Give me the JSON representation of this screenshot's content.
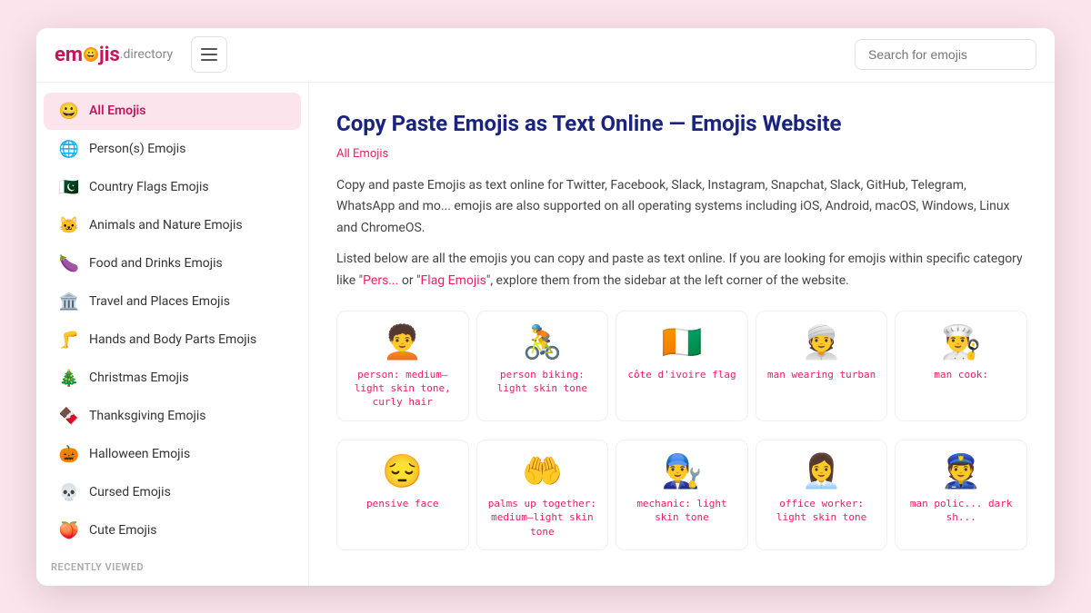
{
  "header": {
    "logo_text": "emojis",
    "logo_dot": ".",
    "logo_directory": "directory",
    "logo_emoji": "😀",
    "hamburger_label": "Menu",
    "search_placeholder": "Search for emojis"
  },
  "sidebar": {
    "items": [
      {
        "id": "all",
        "emoji": "😀",
        "label": "All Emojis",
        "active": true
      },
      {
        "id": "persons",
        "emoji": "🌐",
        "label": "Person(s) Emojis",
        "active": false
      },
      {
        "id": "flags",
        "emoji": "🇵🇰",
        "label": "Country Flags Emojis",
        "active": false
      },
      {
        "id": "animals",
        "emoji": "🐱",
        "label": "Animals and Nature Emojis",
        "active": false
      },
      {
        "id": "food",
        "emoji": "🍆",
        "label": "Food and Drinks Emojis",
        "active": false
      },
      {
        "id": "travel",
        "emoji": "🏛️",
        "label": "Travel and Places Emojis",
        "active": false
      },
      {
        "id": "hands",
        "emoji": "🦵",
        "label": "Hands and Body Parts Emojis",
        "active": false
      },
      {
        "id": "christmas",
        "emoji": "🎄",
        "label": "Christmas Emojis",
        "active": false
      },
      {
        "id": "thanksgiving",
        "emoji": "🍫",
        "label": "Thanksgiving Emojis",
        "active": false
      },
      {
        "id": "halloween",
        "emoji": "🎃",
        "label": "Halloween Emojis",
        "active": false
      },
      {
        "id": "cursed",
        "emoji": "💀",
        "label": "Cursed Emojis",
        "active": false
      },
      {
        "id": "cute",
        "emoji": "🍑",
        "label": "Cute Emojis",
        "active": false
      }
    ],
    "recently_viewed_label": "RECENTLY VIEWED"
  },
  "content": {
    "page_title": "Copy Paste Emojis as Text Online — Emojis Website",
    "breadcrumb": "All Emojis",
    "description1": "Copy and paste Emojis as text online for Twitter, Facebook, Slack, Instagram, Snapchat, Slack, GitHub, Telegram, WhatsApp and mo... emojis are also supported on all operating systems including iOS, Android, macOS, Windows, Linux and ChromeOS.",
    "description2": "Listed below are all the emojis you can copy and paste as text online. If you are looking for emojis within specific category like \"Pers... or \"Flag Emojis\", explore them from the sidebar at the left corner of the website.",
    "link_persons": "Pers...",
    "link_flags": "Flag Emojis"
  },
  "emoji_cards": {
    "row1": [
      {
        "emoji": "🧑‍🦱",
        "name": "person: medium–light\nskin tone, curly hair"
      },
      {
        "emoji": "🚴",
        "name": "person biking: light\nskin tone"
      },
      {
        "emoji": "🇨🇮",
        "name": "côte d'ivoire flag"
      },
      {
        "emoji": "👳",
        "name": "man wearing turban"
      },
      {
        "emoji": "👨‍🍳",
        "name": "man cook:"
      }
    ],
    "row2": [
      {
        "emoji": "😔",
        "name": "pensive face"
      },
      {
        "emoji": "🤲",
        "name": "palms up together:\nmedium–light skin tone"
      },
      {
        "emoji": "👨‍🔧",
        "name": "mechanic: light skin\ntone"
      },
      {
        "emoji": "👩‍💼",
        "name": "office worker: light\nskin tone"
      },
      {
        "emoji": "👮",
        "name": "man polic...\ndark sh..."
      }
    ]
  }
}
